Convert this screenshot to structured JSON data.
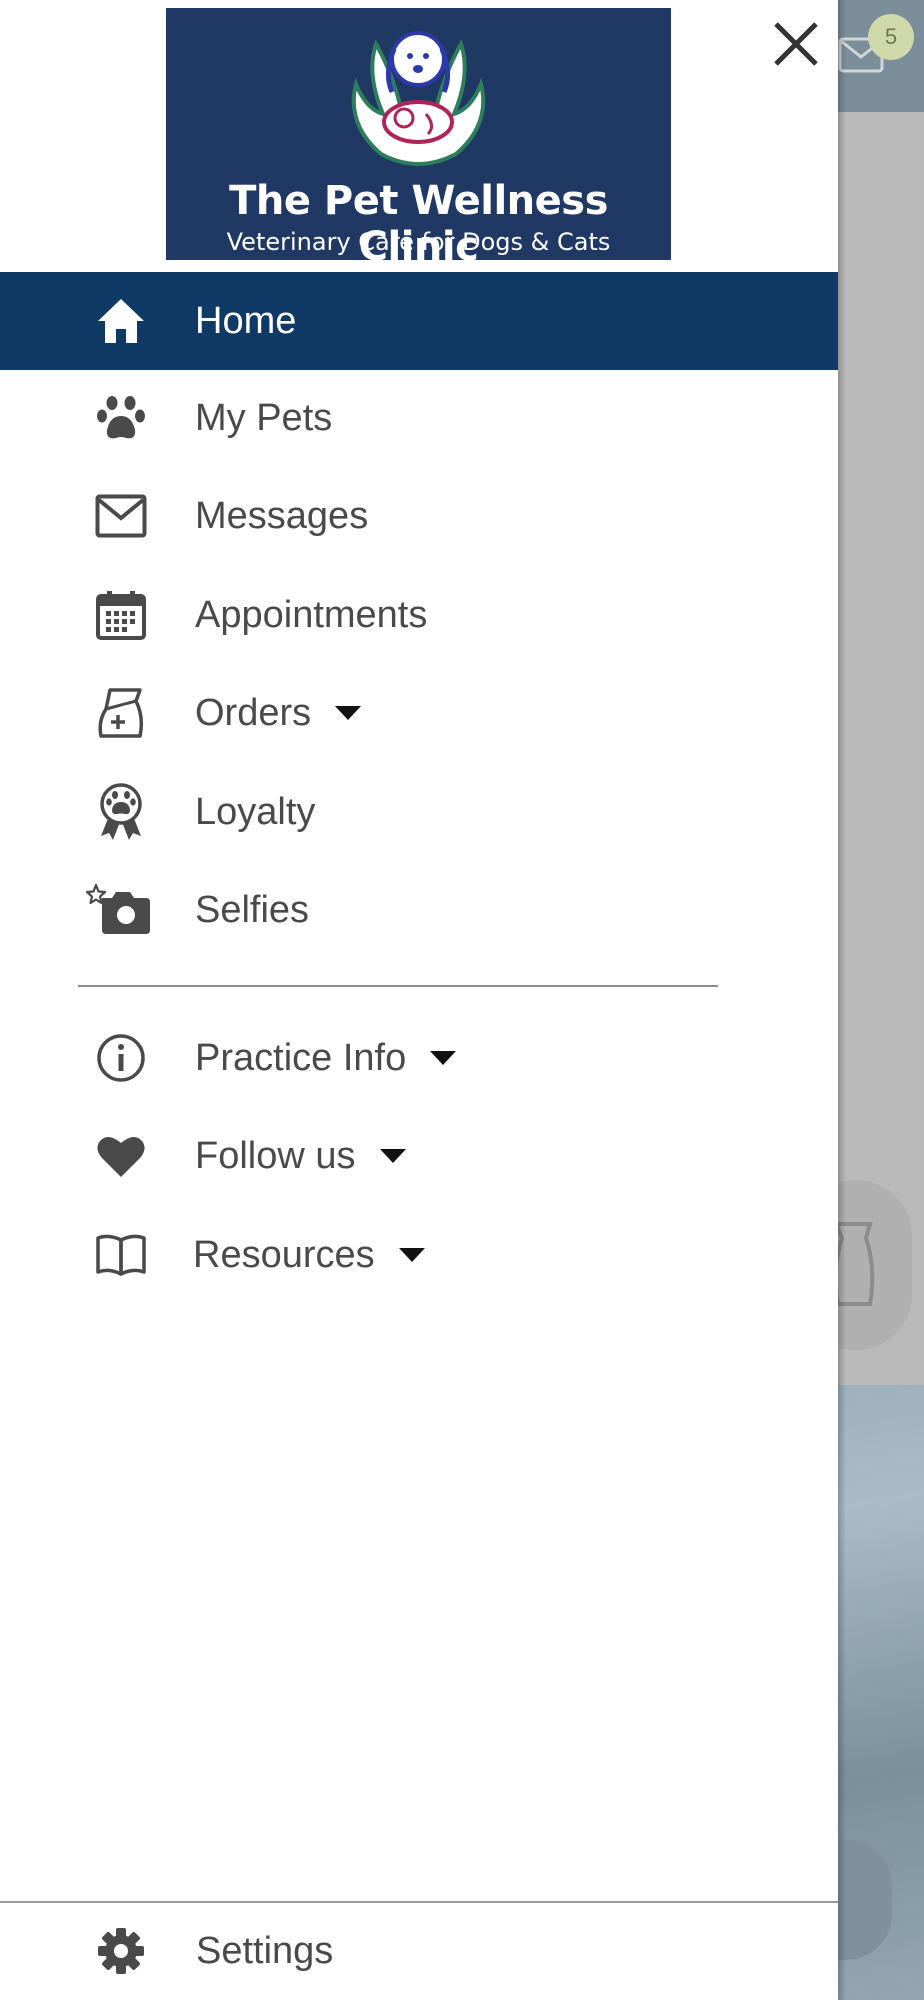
{
  "background": {
    "message_badge_count": "5"
  },
  "logo": {
    "title": "The Pet Wellness Clinic",
    "subtitle": "Veterinary Care for Dogs & Cats"
  },
  "menu": {
    "home": "Home",
    "my_pets": "My Pets",
    "messages": "Messages",
    "appointments": "Appointments",
    "orders": "Orders",
    "loyalty": "Loyalty",
    "selfies": "Selfies",
    "practice_info": "Practice Info",
    "follow_us": "Follow us",
    "resources": "Resources",
    "settings": "Settings"
  },
  "colors": {
    "active_item": "#0f3a66",
    "logo_background": "#1f3864",
    "icon": "#4a4a4a"
  },
  "icons": [
    "close-icon",
    "home-icon",
    "paw-icon",
    "mail-icon",
    "calendar-icon",
    "food-bag-icon",
    "paw-ribbon-icon",
    "camera-icon",
    "info-icon",
    "heart-icon",
    "book-icon",
    "gear-icon"
  ]
}
